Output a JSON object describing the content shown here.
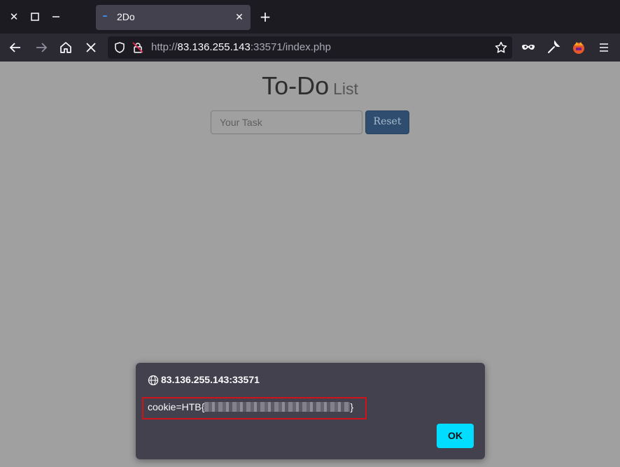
{
  "window": {
    "controls": {
      "close": "✕",
      "maximize": "☐",
      "minimize": "—"
    }
  },
  "tab": {
    "title": "2Do",
    "close": "✕"
  },
  "newtab": "+",
  "navbar": {
    "url_scheme": "http://",
    "url_host": "83.136.255.143",
    "url_rest": ":33571/index.php"
  },
  "page": {
    "heading_main": "To-Do",
    "heading_sub": "List",
    "task_placeholder": "Your Task",
    "reset_label": "Reset"
  },
  "dialog": {
    "origin": "83.136.255.143:33571",
    "message_prefix": "cookie=HTB{",
    "message_suffix": "}",
    "ok_label": "OK"
  },
  "colors": {
    "titlebar": "#1c1b22",
    "navbar": "#2b2a33",
    "page_bg": "#a0a0a0",
    "dialog_bg": "#42414d",
    "ok_button": "#00ddff",
    "highlight_border": "#d0121a"
  }
}
